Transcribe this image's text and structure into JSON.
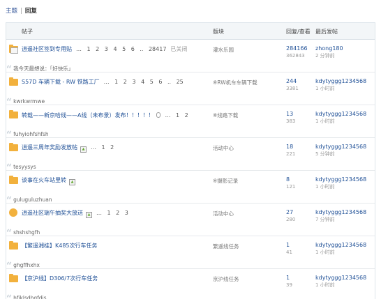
{
  "breadcrumb": {
    "parent": "主题",
    "current": "回复"
  },
  "columns": {
    "topic": "帖子",
    "forum": "版块",
    "stats": "回复/查看",
    "last": "最后发帖"
  },
  "rows": [
    {
      "title": "逍遥社区签到专用贴",
      "pages": "… 1 2 3 4 5 6 .. 28417",
      "closed": "已关闭",
      "forum": "灌水乐园",
      "replies": "284166",
      "views": "362843",
      "user": "zhong180",
      "time": "2 分钟前",
      "quote": "我今天最想说：「好快乐」",
      "icon": "folder-locked-icon",
      "attach": false,
      "clip": false
    },
    {
      "title": "S57D 车辆下载 - RW 铁路工厂",
      "pages": "… 1 2 3 4 5 6 .. 25",
      "closed": "",
      "forum": "※RW机车车辆下载",
      "replies": "244",
      "views": "3381",
      "user": "kdytyggg1234568",
      "time": "1 小时前",
      "quote": "kwrkwrmwe",
      "icon": "folder-icon",
      "attach": false,
      "clip": false
    },
    {
      "title": "转载——新京哈线——A线（未布景）发布！！！！！",
      "pages": "… 1 2",
      "closed": "",
      "forum": "※线路下载",
      "replies": "13",
      "views": "383",
      "user": "kdytyggg1234568",
      "time": "1 小时前",
      "quote": "fuhyiohfshfsh",
      "icon": "folder-icon",
      "attach": false,
      "clip": true
    },
    {
      "title": "逍遥三周年奖励发放帖",
      "pages": "… 1 2",
      "closed": "",
      "forum": "活动中心",
      "replies": "18",
      "views": "221",
      "user": "kdytyggg1234568",
      "time": "5 分钟前",
      "quote": "tesyysys",
      "icon": "folder-icon",
      "attach": true,
      "clip": false
    },
    {
      "title": "谈事在火车站里转",
      "pages": "",
      "closed": "",
      "forum": "※摄影记录",
      "replies": "8",
      "views": "121",
      "user": "kdytyggg1234568",
      "time": "1 小时前",
      "quote": "guluguluzhuan",
      "icon": "folder-icon",
      "attach": true,
      "clip": false
    },
    {
      "title": "逍遥社区端午抽奖大放送",
      "pages": "… 1 2 3",
      "closed": "",
      "forum": "活动中心",
      "replies": "27",
      "views": "280",
      "user": "kdytyggg1234568",
      "time": "7 分钟前",
      "quote": "shshshgfh",
      "icon": "folder-user-icon",
      "attach": true,
      "clip": false
    },
    {
      "title": "【繁遥湘桂】K485次行车任务",
      "pages": "",
      "closed": "",
      "forum": "繁遥线任务",
      "replies": "1",
      "views": "41",
      "user": "kdytyggg1234568",
      "time": "1 小时前",
      "quote": "ghgffhxhx",
      "icon": "folder-icon",
      "attach": false,
      "clip": false
    },
    {
      "title": "【京沪线】D306/7次行车任务",
      "pages": "",
      "closed": "",
      "forum": "京沪线任务",
      "replies": "1",
      "views": "39",
      "user": "kdytyggg1234568",
      "time": "1 小时前",
      "quote": "hfjklsdhgfdjs",
      "icon": "folder-icon",
      "attach": false,
      "clip": false
    }
  ]
}
